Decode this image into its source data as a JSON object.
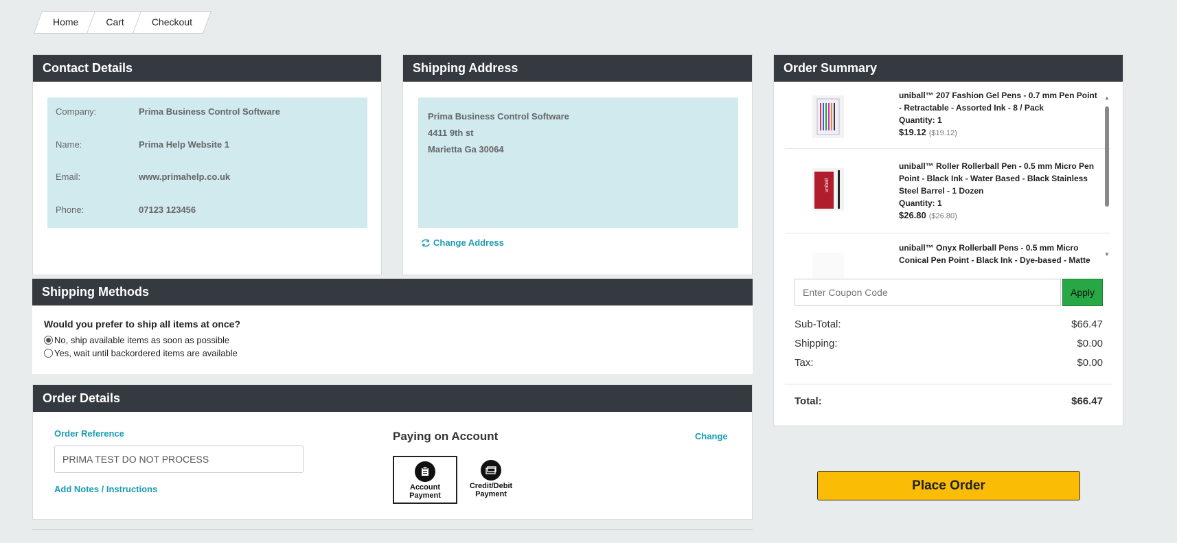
{
  "breadcrumb": [
    "Home",
    "Cart",
    "Checkout"
  ],
  "contact": {
    "title": "Contact Details",
    "rows": [
      {
        "label": "Company:",
        "value": "Prima Business Control Software"
      },
      {
        "label": "Name:",
        "value": "Prima Help Website 1"
      },
      {
        "label": "Email:",
        "value": "www.primahelp.co.uk"
      },
      {
        "label": "Phone:",
        "value": "07123 123456"
      }
    ]
  },
  "address": {
    "title": "Shipping Address",
    "lines": [
      "Prima Business Control Software",
      "4411 9th st",
      "Marietta Ga 30064"
    ],
    "change_label": "Change Address"
  },
  "methods": {
    "title": "Shipping Methods",
    "question": "Would you prefer to ship all items at once?",
    "options": [
      {
        "label": "No, ship available items as soon as possible",
        "selected": true
      },
      {
        "label": "Yes, wait until backordered items are available",
        "selected": false
      }
    ]
  },
  "details": {
    "title": "Order Details",
    "ref_label": "Order Reference",
    "ref_value": "PRIMA TEST DO NOT PROCESS",
    "notes_label": "Add Notes / Instructions",
    "pay_title": "Paying on Account",
    "change_label": "Change",
    "payment_options": [
      {
        "line1": "Account",
        "line2": "Payment",
        "icon": "document-icon",
        "selected": true
      },
      {
        "line1": "Credit/Debit",
        "line2": "Payment",
        "icon": "card-icon",
        "selected": false
      }
    ]
  },
  "summary": {
    "title": "Order Summary",
    "items": [
      {
        "name": "uniball™ 207 Fashion Gel Pens - 0.7 mm Pen Point - Retractable - Assorted Ink - 8 / Pack",
        "qty": "Quantity: 1",
        "price": "$19.12",
        "unit": "($19.12)"
      },
      {
        "name": "uniball™ Roller Rollerball Pen - 0.5 mm Micro Pen Point - Black Ink - Water Based - Black Stainless Steel Barrel - 1 Dozen",
        "qty": "Quantity: 1",
        "price": "$26.80",
        "unit": "($26.80)"
      },
      {
        "name": "uniball™ Onyx Rollerball Pens - 0.5 mm Micro Conical Pen Point - Black Ink - Dye-based - Matte",
        "qty": "",
        "price": "",
        "unit": ""
      }
    ],
    "coupon_placeholder": "Enter Coupon Code",
    "apply_label": "Apply",
    "subtotal_label": "Sub-Total:",
    "subtotal": "$66.47",
    "shipping_label": "Shipping:",
    "shipping": "$0.00",
    "tax_label": "Tax:",
    "tax": "$0.00",
    "total_label": "Total:",
    "total": "$66.47"
  },
  "place_order_label": "Place Order"
}
